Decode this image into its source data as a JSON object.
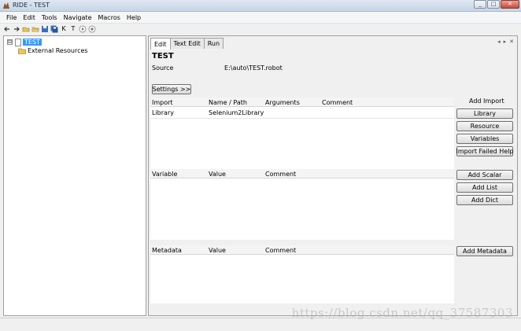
{
  "window": {
    "title": "RIDE - TEST"
  },
  "menu": [
    "File",
    "Edit",
    "Tools",
    "Navigate",
    "Macros",
    "Help"
  ],
  "toolbar_icons": [
    "back-arrow-icon",
    "forward-arrow-icon",
    "open-folder-icon",
    "open-directory-icon",
    "save-icon",
    "save-all-icon",
    "search-keywords-icon",
    "search-tests-icon",
    "run-icon",
    "stop-icon"
  ],
  "toolbar_glyphs": {
    "keyword": "K",
    "test": "T"
  },
  "tree": {
    "root": "TEST",
    "expander": "⊟",
    "children": [
      "External Resources"
    ]
  },
  "tabs": [
    "Edit",
    "Text Edit",
    "Run"
  ],
  "suite": {
    "name": "TEST",
    "source_label": "Source",
    "source_value": "E:\\auto\\TEST.robot"
  },
  "settings_button": "Settings >>",
  "imports": {
    "headers": [
      "Import",
      "Name / Path",
      "Arguments",
      "Comment"
    ],
    "rows": [
      [
        "Library",
        "Selenium2Library",
        "",
        ""
      ]
    ],
    "side_title": "Add Import",
    "buttons": [
      "Library",
      "Resource",
      "Variables",
      "Import Failed Help"
    ]
  },
  "variables": {
    "headers": [
      "Variable",
      "Value",
      "Comment"
    ],
    "buttons": [
      "Add Scalar",
      "Add List",
      "Add Dict"
    ]
  },
  "metadata": {
    "headers": [
      "Metadata",
      "Value",
      "Comment"
    ],
    "buttons": [
      "Add Metadata"
    ]
  },
  "watermark": "https://blog.csdn.net/qq_37587303",
  "colors": {
    "selection": "#3399ff",
    "window_bg": "#f0f0f0"
  }
}
